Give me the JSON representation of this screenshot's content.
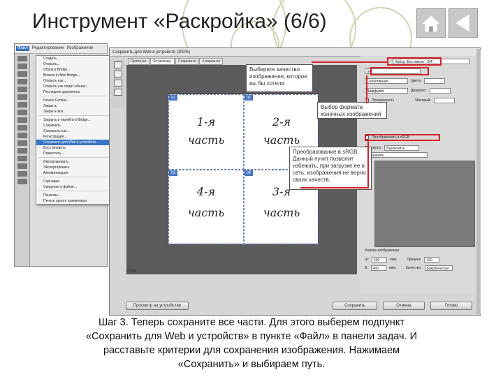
{
  "title": "Инструмент «Раскройка» (6/6)",
  "nav": {
    "home_icon": "home-icon",
    "back_icon": "back-arrow-icon"
  },
  "photoshop": {
    "menubar": [
      "Файл",
      "Редактирование",
      "Изображение"
    ],
    "file_menu": [
      "Создать...",
      "Открыть...",
      "Обзор в Bridge...",
      "Browse in Mini Bridge...",
      "Открыть как...",
      "Открыть как смарт-объект...",
      "Последние документы",
      "Device Central...",
      "Закрыть",
      "Закрыть все",
      "Закрыть и перейти в Bridge...",
      "Сохранить",
      "Сохранить как...",
      "Регистрация...",
      "Сохранить для Web и устройств...",
      "Восстановить",
      "Поместить...",
      "Импортировать",
      "Экспортировать",
      "Автоматизация",
      "Сценарии",
      "Сведения о файле...",
      "Печатать...",
      "Печать одного экземпляра"
    ],
    "file_menu_selected": 14
  },
  "dialog": {
    "title": "Сохранить для Web и устройств (100%)",
    "tabs": [
      "Оригинал",
      "Оптимизир.",
      "2 варианта",
      "4 варианта"
    ],
    "active_tab": 1,
    "preset_label": "Набор: Без имени - GIF",
    "format_value": "GIF",
    "rows": [
      {
        "label": "Селективная",
        "value": "",
        "right_label": "Цвета:",
        "right_value": ""
      },
      {
        "label": "Диффузия",
        "value": "",
        "right_label": "Дизеринг:",
        "right_value": ""
      },
      {
        "label": "Прозрачность",
        "value": "",
        "right_label": "Матовый:",
        "right_value": ""
      }
    ],
    "convert_label": "Преобразовать в sRGB",
    "preview_label": "Просмотр:",
    "preview_value": "Выключить",
    "metadata_value": "Сохранить",
    "image_size_label": "Размер изображения",
    "w_label": "Ш:",
    "w_value": "400",
    "h_label": "В:",
    "h_value": "400",
    "units": "пикс",
    "percent_label": "Процент:",
    "percent_value": "100",
    "quality_label": "Качество:",
    "quality_value": "Бикубическая",
    "status_zoom": "100%",
    "buttons": {
      "preview": "Просмотр на устройстве",
      "save": "Сохранить",
      "cancel": "Отмена",
      "done": "Готово"
    }
  },
  "canvas_labels": {
    "q1_top": "1-я",
    "q1_bottom": "часть",
    "q2_top": "2-я",
    "q2_bottom": "часть",
    "q4_top": "4-я",
    "q4_bottom": "часть",
    "q3_top": "3-я",
    "q3_bottom": "часть"
  },
  "callouts": {
    "quality": "Выберите качество изображения, которое вы бы хотели.",
    "format": "Выбор формата конечных изображений",
    "convert": "Преобразование в sRGB. Данный пункт позволит избежать, при загрузке ее в сеть, изображения не верно своих качеств."
  },
  "caption": {
    "line1": "Шаг 3. Теперь сохраните все части. Для этого выберем подпункт",
    "line2": "«Сохранить для Web и устройств» в пункте «Файл» в панели задач. И",
    "line3": "расставьте критерии для сохранения изображения. Нажимаем",
    "line4": "«Сохранить» и выбираем путь."
  },
  "colors": {
    "highlight": "#d2232a",
    "menu_selection": "#3875c4",
    "canvas_bg": "#5b5b5b"
  }
}
